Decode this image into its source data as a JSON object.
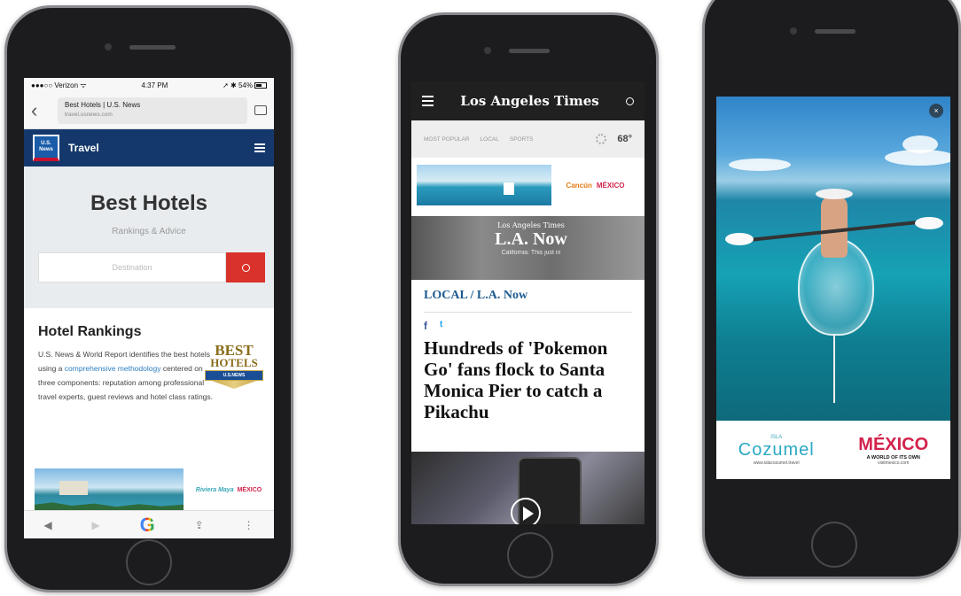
{
  "phone1": {
    "status": {
      "carrier": "Verizon",
      "time": "4:37 PM",
      "battery": "54%"
    },
    "url": {
      "title": "Best Hotels | U.S. News",
      "domain": "travel.usnews.com"
    },
    "header": {
      "logo_line1": "U.S.",
      "logo_line2": "News",
      "section": "Travel"
    },
    "hero": {
      "title": "Best Hotels",
      "subtitle": "Rankings & Advice"
    },
    "search": {
      "placeholder": "Destination"
    },
    "rankings": {
      "heading": "Hotel Rankings",
      "text_before": "U.S. News & World Report identifies the best hotels using a ",
      "link": "comprehensive methodology",
      "text_after": " centered on three components: reputation among professional travel experts, guest reviews and hotel class ratings."
    },
    "badge": {
      "line1": "BEST",
      "line2": "HOTELS",
      "ribbon": "U.S.NEWS"
    },
    "ad": {
      "brand1": "Riviera Maya",
      "brand2": "MÉXICO"
    },
    "bottombar": {
      "back": "◀",
      "forward": "▶",
      "google": "G",
      "share": "⇪",
      "more": "⋮"
    }
  },
  "phone2": {
    "header": {
      "logo": "Los Angeles Times"
    },
    "nav": {
      "items": [
        "MOST POPULAR",
        "LOCAL",
        "SPORTS"
      ],
      "temperature": "68°"
    },
    "ad": {
      "brand1": "Cancún",
      "brand2": "MÉXICO"
    },
    "lanow": {
      "top": "Los Angeles Times",
      "title": "L.A. Now",
      "caption": "California: This just in"
    },
    "kicker": "LOCAL / L.A. Now",
    "social": {
      "facebook": "f",
      "twitter": "t"
    },
    "headline": "Hundreds of 'Pokemon Go' fans flock to Santa Monica Pier to catch a Pikachu"
  },
  "phone3": {
    "close": "×",
    "cozumel": {
      "isla": "ISLA",
      "name": "Cozumel",
      "web": "www.islacozumel.travel"
    },
    "mexico": {
      "name": "MÉXICO",
      "tagline": "A WORLD OF ITS OWN",
      "web": "visitmexico.com"
    }
  }
}
